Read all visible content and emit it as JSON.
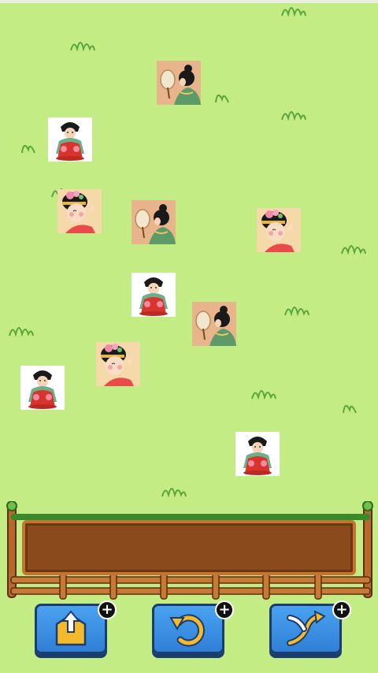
{
  "game": {
    "board_tiles": [
      {
        "kind": "fan-lady-tile"
      },
      {
        "kind": "white-lady-tile"
      },
      {
        "kind": "flower-lady-tile"
      },
      {
        "kind": "fan-lady-tile"
      },
      {
        "kind": "flower-lady-tile"
      },
      {
        "kind": "white-lady-tile"
      },
      {
        "kind": "fan-lady-tile"
      },
      {
        "kind": "flower-lady-tile"
      },
      {
        "kind": "white-lady-tile"
      },
      {
        "kind": "white-lady-tile"
      }
    ],
    "collection_slot": {
      "tiles": []
    },
    "tools": [
      {
        "name": "pop-out",
        "icon": "pop-out-icon",
        "badge": "+"
      },
      {
        "name": "undo",
        "icon": "undo-icon",
        "badge": "+"
      },
      {
        "name": "shuffle",
        "icon": "shuffle-icon",
        "badge": "+"
      }
    ]
  },
  "colors": {
    "background": "#c3ec85",
    "grass": "#5aa53c",
    "slot": "#8a4a1c",
    "fence": "#c27430",
    "button": "#2f7fd6"
  }
}
